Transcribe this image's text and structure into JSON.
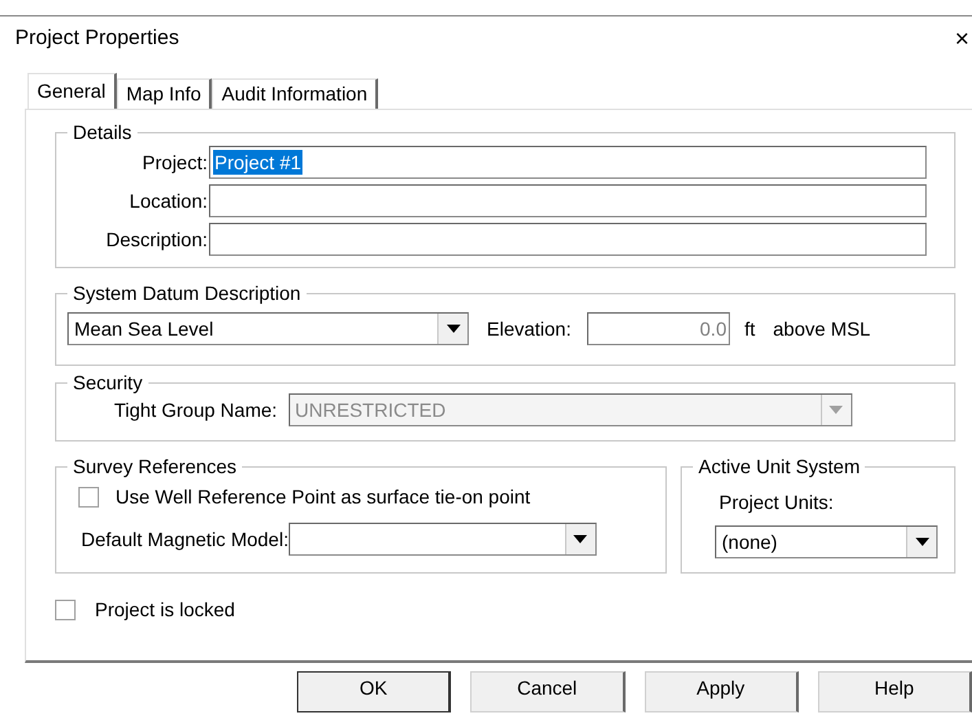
{
  "window": {
    "title": "Project Properties",
    "close": "×"
  },
  "tabs": [
    {
      "label": "General",
      "selected": true
    },
    {
      "label": "Map Info",
      "selected": false
    },
    {
      "label": "Audit Information",
      "selected": false
    }
  ],
  "details": {
    "title": "Details",
    "fields": [
      {
        "label": "Project:",
        "value": "Project #1",
        "text_selected": true
      },
      {
        "label": "Location:"
      },
      {
        "label": "Description:"
      }
    ]
  },
  "datum": {
    "title": "System Datum Description",
    "value": "Mean Sea Level",
    "elevation_label": "Elevation:",
    "elevation_value": "0.0",
    "unit": "ft",
    "reference": "above MSL"
  },
  "security": {
    "title": "Security",
    "label": "Tight Group Name:",
    "value": "UNRESTRICTED",
    "disabled": true
  },
  "survey": {
    "title": "Survey References",
    "checkbox": {
      "label": "Use Well Reference Point as surface tie-on point",
      "checked": false
    },
    "model_label": "Default Magnetic Model:"
  },
  "units": {
    "title": "Active Unit System",
    "label": "Project Units:",
    "value": "(none)"
  },
  "locked": {
    "label": "Project is locked",
    "checked": false
  },
  "buttons": [
    {
      "label": "OK",
      "default": true
    },
    {
      "label": "Cancel",
      "default": false
    },
    {
      "label": "Apply",
      "default": false
    },
    {
      "label": "Help",
      "default": false
    }
  ]
}
